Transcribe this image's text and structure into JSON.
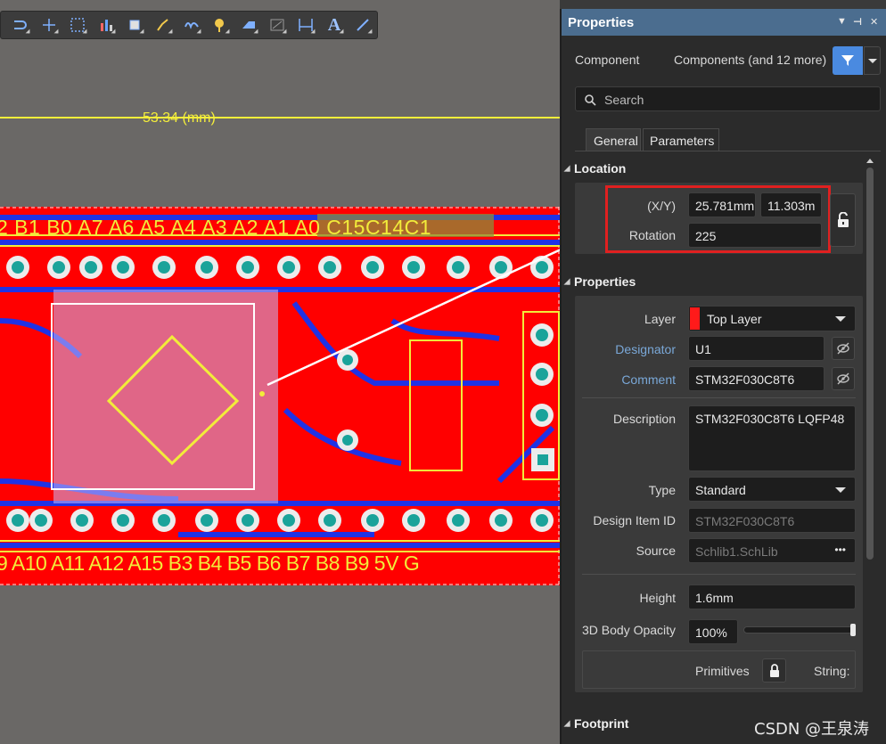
{
  "toolbar": {
    "icons": [
      "route-icon",
      "cross-probe-icon",
      "select-rect-icon",
      "bar-chart-icon",
      "component-icon",
      "interactive-route-icon",
      "diff-pair-icon",
      "via-icon",
      "fill-icon",
      "region-icon",
      "dimension-icon",
      "string-icon",
      "line-icon"
    ],
    "text_tool_label": "A"
  },
  "canvas": {
    "dimension_label": "53.34 (mm)",
    "top_pin_labels": "2 B1 B0 A7 A6 A5 A4 A3 A2 A1 A0 C15C14C1",
    "bottom_pin_labels": "9 A10 A11 A12 A15 B3 B4 B5 B6 B7 B8 B9 5V G",
    "colors": {
      "board": "#ff0000",
      "copper_bottom": "#1f32e6",
      "silk": "#f2ec3a",
      "pad": "#1aa39a"
    }
  },
  "panel": {
    "title": "Properties",
    "component_label": "Component",
    "selection_summary": "Components (and 12 more)",
    "search_placeholder": "Search",
    "tabs": [
      "General",
      "Parameters"
    ],
    "location": {
      "section": "Location",
      "xy_label": "(X/Y)",
      "x": "25.781mm",
      "y": "11.303m",
      "rotation_label": "Rotation",
      "rotation": "225"
    },
    "properties": {
      "section": "Properties",
      "layer_label": "Layer",
      "layer": "Top Layer",
      "layer_color": "#ff1a1a",
      "designator_label": "Designator",
      "designator": "U1",
      "comment_label": "Comment",
      "comment": "STM32F030C8T6",
      "description_label": "Description",
      "description": "STM32F030C8T6 LQFP48",
      "type_label": "Type",
      "type": "Standard",
      "design_item_id_label": "Design Item ID",
      "design_item_id": "STM32F030C8T6",
      "source_label": "Source",
      "source": "Schlib1.SchLib",
      "source_more": "•••",
      "height_label": "Height",
      "height": "1.6mm",
      "opacity_label": "3D Body Opacity",
      "opacity": "100%",
      "opacity_value": 1.0,
      "primitives_label": "Primitives",
      "strings_label": "String:"
    },
    "footprint_section": "Footprint"
  },
  "watermark": "CSDN @王泉涛"
}
